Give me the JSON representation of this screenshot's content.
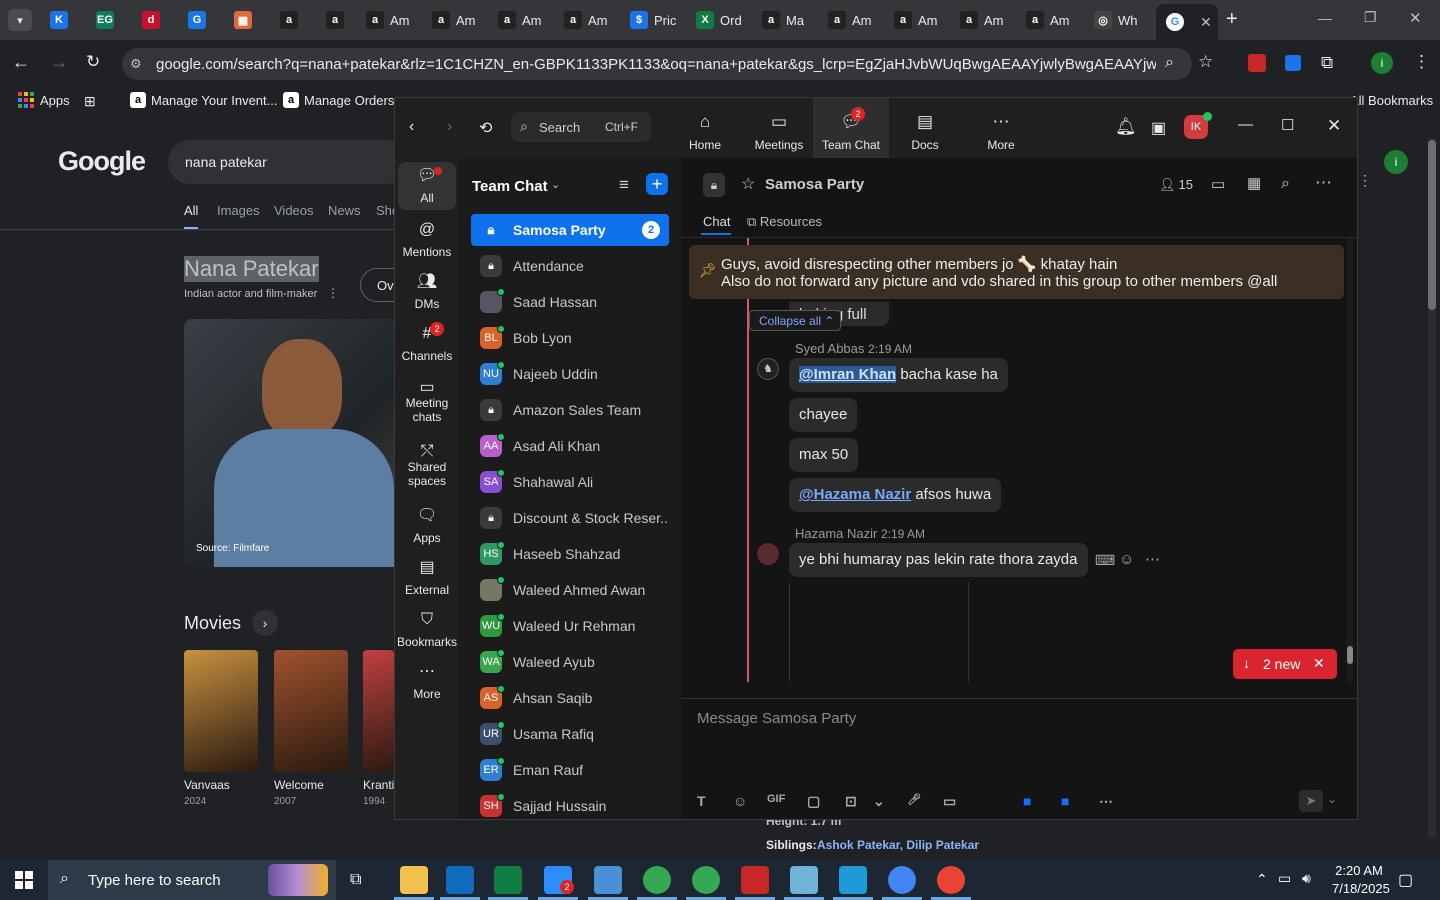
{
  "browser": {
    "tabs": [
      {
        "fav": "K",
        "color": "#1a73e8",
        "label": ""
      },
      {
        "fav": "EG",
        "color": "#0b7f5b",
        "label": ""
      },
      {
        "fav": "d",
        "color": "#c8102e",
        "label": ""
      },
      {
        "fav": "G",
        "color": "#1a73e8",
        "label": ""
      },
      {
        "fav": "▦",
        "color": "#e0683c",
        "label": ""
      },
      {
        "fav": "a",
        "color": "#222",
        "label": ""
      },
      {
        "fav": "a",
        "color": "#222",
        "label": ""
      },
      {
        "fav": "a",
        "color": "#222",
        "label": "Am"
      },
      {
        "fav": "a",
        "color": "#222",
        "label": "Am"
      },
      {
        "fav": "a",
        "color": "#222",
        "label": "Am"
      },
      {
        "fav": "a",
        "color": "#222",
        "label": "Am"
      },
      {
        "fav": "$",
        "color": "#1a73e8",
        "label": "Pric"
      },
      {
        "fav": "X",
        "color": "#107c41",
        "label": "Ord"
      },
      {
        "fav": "a",
        "color": "#222",
        "label": "Ma"
      },
      {
        "fav": "a",
        "color": "#222",
        "label": "Am"
      },
      {
        "fav": "a",
        "color": "#222",
        "label": "Am"
      },
      {
        "fav": "a",
        "color": "#222",
        "label": "Am"
      },
      {
        "fav": "a",
        "color": "#222",
        "label": "Am"
      },
      {
        "fav": "◎",
        "color": "#444",
        "label": "Wh"
      }
    ],
    "url": "google.com/search?q=nana+patekar&rlz=1C1CHZN_en-GBPK1133PK1133&oq=nana+patekar&gs_lcrp=EgZjaHJvbWUqBwgAEAAYjwlyBwgAEAAYjwlyCggBEC4...",
    "bookmarks": {
      "apps": "Apps",
      "b1": "Manage Your Invent...",
      "b2": "Manage Orders",
      "all": "All Bookmarks"
    }
  },
  "google": {
    "logo": "Google",
    "query": "nana patekar",
    "tabs": [
      "All",
      "Images",
      "Videos",
      "News",
      "Sho"
    ],
    "entity_title": "Nana Patekar",
    "entity_sub": "Indian actor and film-maker",
    "overview_btn": "Ov",
    "source": "Source: Filmfare",
    "movies_heading": "Movies",
    "movies": [
      {
        "title": "Vanvaas",
        "year": "2024",
        "color": "#c89040"
      },
      {
        "title": "Welcome",
        "year": "2007",
        "color": "#a0522d"
      },
      {
        "title": "Kranti",
        "year": "1994",
        "color": "#c04040"
      }
    ],
    "height_line": "Height: 1.7 m",
    "siblings_label": "Siblings:",
    "siblings": "Ashok Patekar, Dilip Patekar"
  },
  "zoom": {
    "search_label": "Search",
    "search_shortcut": "Ctrl+F",
    "nav": [
      {
        "label": "Home",
        "badge": ""
      },
      {
        "label": "Meetings",
        "badge": ""
      },
      {
        "label": "Team Chat",
        "badge": "2"
      },
      {
        "label": "Docs",
        "badge": ""
      },
      {
        "label": "More",
        "badge": ""
      }
    ],
    "avatar_initials": "IK",
    "rail": [
      {
        "label": "All",
        "badge": ""
      },
      {
        "label": "Mentions",
        "badge": ""
      },
      {
        "label": "DMs",
        "badge": ""
      },
      {
        "label": "Channels",
        "badge": "2"
      },
      {
        "label": "Meeting chats",
        "badge": ""
      },
      {
        "label": "Shared spaces",
        "badge": ""
      },
      {
        "label": "Apps",
        "badge": ""
      },
      {
        "label": "External",
        "badge": ""
      },
      {
        "label": "Bookmarks",
        "badge": ""
      },
      {
        "label": "More",
        "badge": ""
      }
    ],
    "list_title": "Team Chat",
    "channels": [
      {
        "name": "Samosa Party",
        "type": "lock",
        "badge": "2",
        "active": true
      },
      {
        "name": "Attendance",
        "type": "lock"
      },
      {
        "name": "Saad Hassan",
        "type": "img",
        "color": "#556"
      },
      {
        "name": "Bob Lyon",
        "type": "av",
        "initials": "BL",
        "color": "#d9622b"
      },
      {
        "name": "Najeeb Uddin",
        "type": "av",
        "initials": "NU",
        "color": "#2f7fd1"
      },
      {
        "name": "Amazon Sales Team",
        "type": "lock"
      },
      {
        "name": "Asad Ali Khan",
        "type": "av",
        "initials": "AA",
        "color": "#b85fc9"
      },
      {
        "name": "Shahawal Ali",
        "type": "av",
        "initials": "SA",
        "color": "#8a4fd0"
      },
      {
        "name": "Discount & Stock Reser...",
        "type": "lock"
      },
      {
        "name": "Haseeb Shahzad",
        "type": "av",
        "initials": "HS",
        "color": "#2e9a62"
      },
      {
        "name": "Waleed Ahmed Awan",
        "type": "img",
        "color": "#776"
      },
      {
        "name": "Waleed Ur Rehman",
        "type": "av",
        "initials": "WU",
        "color": "#2e9a3e"
      },
      {
        "name": "Waleed Ayub",
        "type": "av",
        "initials": "WA",
        "color": "#3aa54a"
      },
      {
        "name": "Ahsan Saqib",
        "type": "av",
        "initials": "AS",
        "color": "#d9622b"
      },
      {
        "name": "Usama Rafiq",
        "type": "av",
        "initials": "UR",
        "color": "#3d4f6e"
      },
      {
        "name": "Eman Rauf",
        "type": "av",
        "initials": "ER",
        "color": "#2f7fd1"
      },
      {
        "name": "Sajjad Hussain",
        "type": "av",
        "initials": "SH",
        "color": "#c73232"
      }
    ],
    "chat": {
      "title": "Samosa Party",
      "members": "15",
      "tab_chat": "Chat",
      "tab_resources": "Resources",
      "pinned_line1": "Guys, avoid disrespecting other members jo 🦴 khatay hain",
      "pinned_line2": "Also do not forward any picture and vdo shared in this group to other members @all",
      "partial_text": "baking full",
      "collapse_all": "Collapse all",
      "sender1": "Syed Abbas",
      "time1": "2:19 AM",
      "msg1_mention": "@Imran Khan",
      "msg1_rest": " bacha kase ha",
      "msg2": "chayee",
      "msg3": "max 50",
      "msg4_mention": "@Hazama Nazir",
      "msg4_rest": " afsos huwa",
      "sender2": "Hazama Nazir",
      "time2": "2:19 AM",
      "msg5": "ye bhi humaray pas lekin rate thora zayda",
      "new_count": "2 new",
      "composer_placeholder": "Message Samosa Party"
    }
  },
  "taskbar": {
    "search_placeholder": "Type here to search",
    "time": "2:20 AM",
    "date": "7/18/2025",
    "zoom_badge": "2"
  }
}
